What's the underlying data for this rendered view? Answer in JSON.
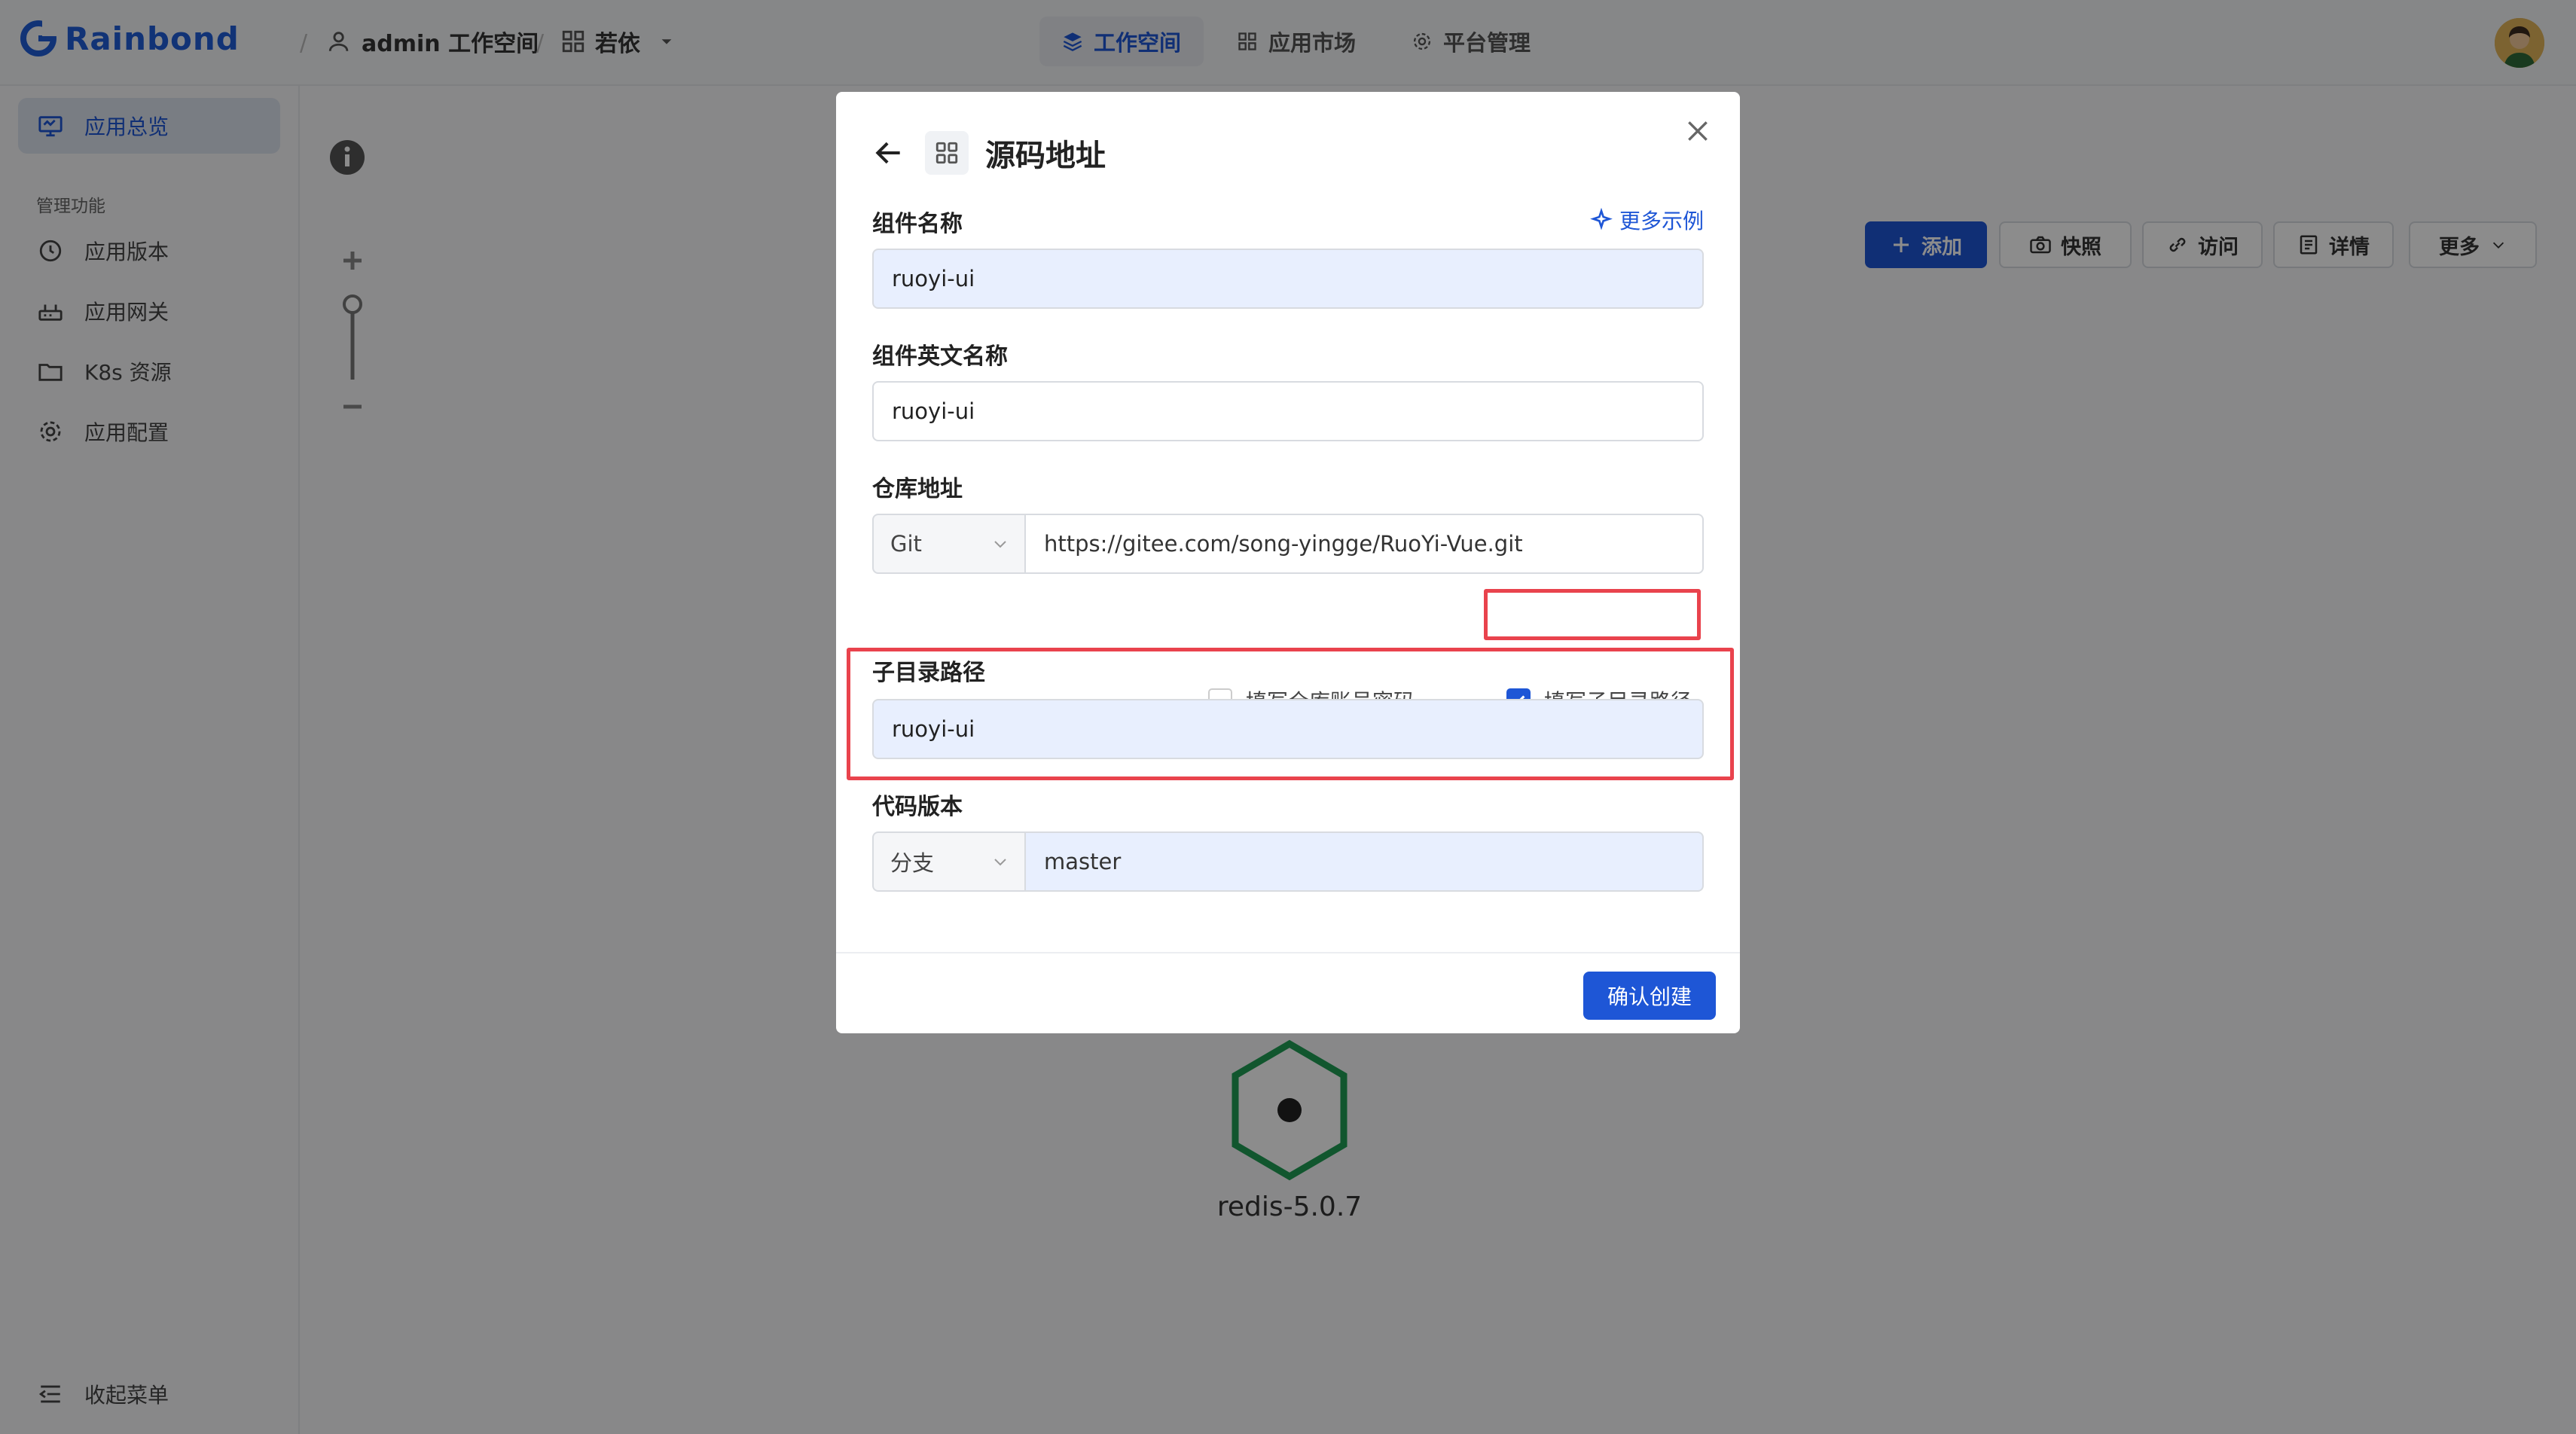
{
  "topbar": {
    "brand": "Rainbond",
    "workspace": "admin 工作空间",
    "app": "若依",
    "tabs": [
      {
        "label": "工作空间",
        "active": true
      },
      {
        "label": "应用市场",
        "active": false
      },
      {
        "label": "平台管理",
        "active": false
      }
    ]
  },
  "sidebar": {
    "overview": "应用总览",
    "section": "管理功能",
    "items": [
      "应用版本",
      "应用网关",
      "K8s 资源",
      "应用配置"
    ],
    "collapse": "收起菜单"
  },
  "toolbar": {
    "add": "添加",
    "snapshot": "快照",
    "visit": "访问",
    "detail": "详情",
    "more": "更多"
  },
  "canvas": {
    "node_label": "redis-5.0.7"
  },
  "modal": {
    "title": "源码地址",
    "more_examples": "更多示例",
    "component_name_label": "组件名称",
    "component_name_value": "ruoyi-ui",
    "component_en_label": "组件英文名称",
    "component_en_value": "ruoyi-ui",
    "repo_label": "仓库地址",
    "repo_type": "Git",
    "repo_url": "https://gitee.com/song-yingge/RuoYi-Vue.git",
    "check_account": "填写仓库账号密码",
    "check_account_checked": false,
    "check_subdir": "填写子目录路径",
    "check_subdir_checked": true,
    "subdir_label": "子目录路径",
    "subdir_value": "ruoyi-ui",
    "version_label": "代码版本",
    "version_type": "分支",
    "version_value": "master",
    "confirm": "确认创建"
  },
  "colors": {
    "primary": "#1e56d6",
    "highlight": "#e9434d",
    "node": "#1f9d55"
  }
}
